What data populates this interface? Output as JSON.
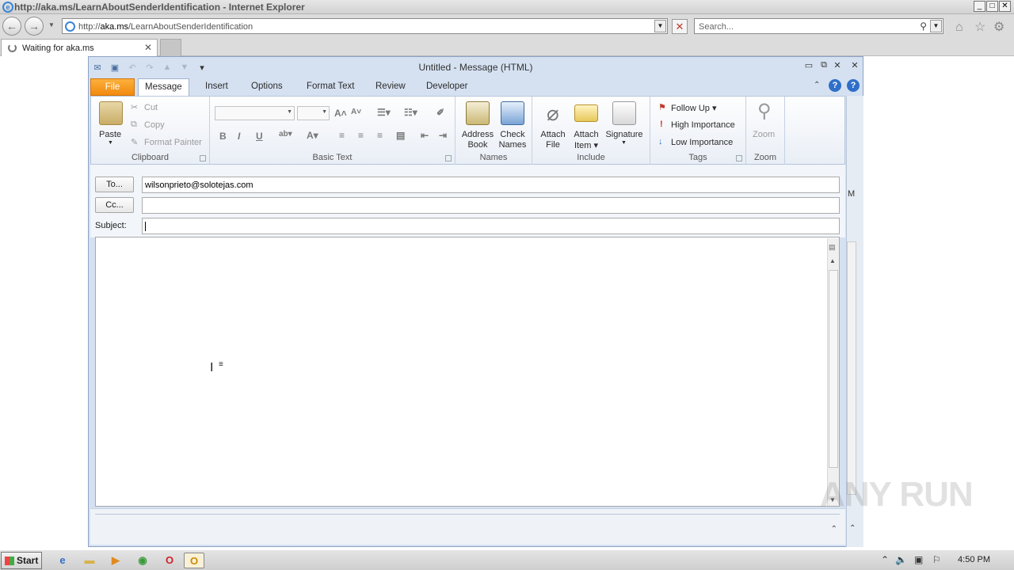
{
  "ie": {
    "title": "http://aka.ms/LearnAboutSenderIdentification - Internet Explorer",
    "address_prefix": "http://",
    "address_host": "aka.ms",
    "address_path": "/LearnAboutSenderIdentification",
    "search_placeholder": "Search...",
    "tab_label": "Waiting for aka.ms"
  },
  "outlook": {
    "window_title": "Untitled  -  Message (HTML)",
    "tabs": [
      "File",
      "Message",
      "Insert",
      "Options",
      "Format Text",
      "Review",
      "Developer"
    ],
    "clipboard": {
      "label": "Clipboard",
      "paste": "Paste",
      "cut": "Cut",
      "copy": "Copy",
      "format_painter": "Format Painter"
    },
    "basic_text": {
      "label": "Basic Text"
    },
    "names": {
      "label": "Names",
      "address_book": [
        "Address",
        "Book"
      ],
      "check_names": [
        "Check",
        "Names"
      ]
    },
    "include": {
      "label": "Include",
      "attach_file": [
        "Attach",
        "File"
      ],
      "attach_item": [
        "Attach",
        "Item"
      ],
      "signature": "Signature"
    },
    "tags": {
      "label": "Tags",
      "follow_up": "Follow Up",
      "high": "High Importance",
      "low": "Low Importance"
    },
    "zoom": {
      "label": "Zoom",
      "button": "Zoom"
    },
    "form": {
      "to_button": "To...",
      "cc_button": "Cc...",
      "subject_label": "Subject:",
      "to_value": "wilsonprieto@solotejas.com",
      "cc_value": "",
      "subject_value": ""
    },
    "right_strip_letter": "M"
  },
  "taskbar": {
    "start": "Start",
    "clock": "4:50 PM"
  },
  "watermark": "ANY RUN"
}
